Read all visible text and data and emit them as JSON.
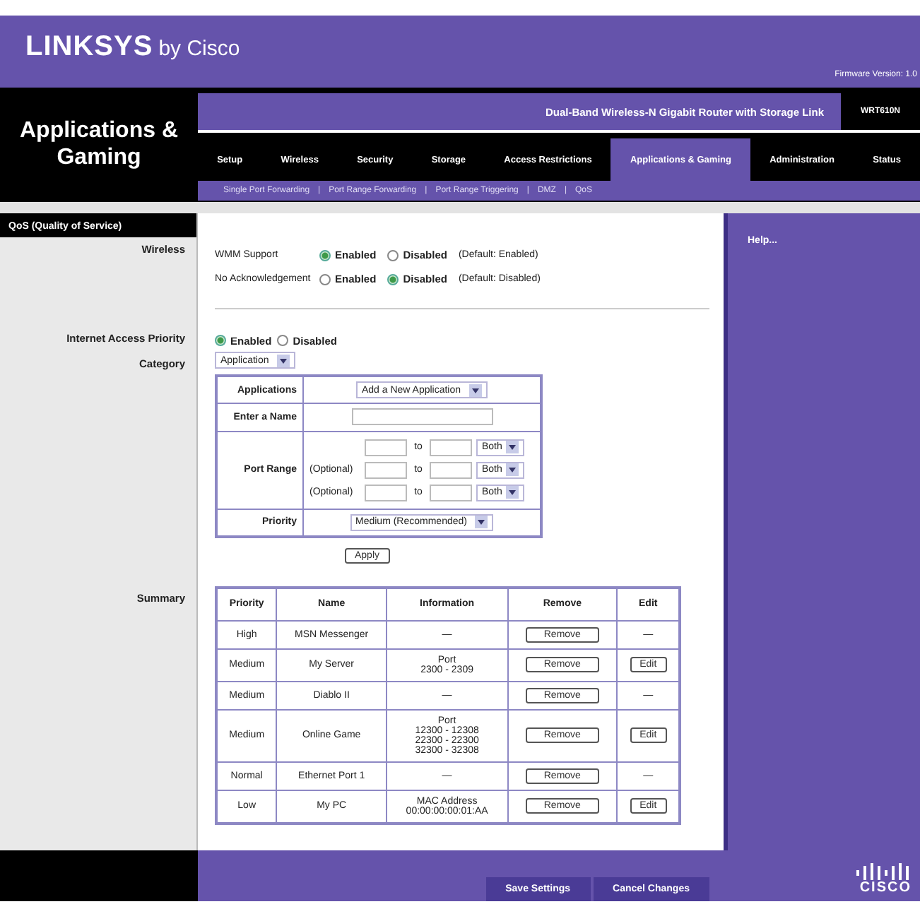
{
  "header": {
    "logo": "LINKSYS",
    "logo_suffix": "by Cisco",
    "firmware": "Firmware Version: 1.0"
  },
  "section_title": "Applications & Gaming",
  "product": "Dual-Band Wireless-N Gigabit Router with Storage Link",
  "model": "WRT610N",
  "tabs": [
    {
      "label": "Setup",
      "selected": false
    },
    {
      "label": "Wireless",
      "selected": false
    },
    {
      "label": "Security",
      "selected": false
    },
    {
      "label": "Storage",
      "selected": false
    },
    {
      "label": "Access Restrictions",
      "selected": false
    },
    {
      "label": "Applications & Gaming",
      "selected": true
    },
    {
      "label": "Administration",
      "selected": false
    },
    {
      "label": "Status",
      "selected": false
    }
  ],
  "subtabs": {
    "separator": "|",
    "items": [
      "Single Port Forwarding",
      "Port Range Forwarding",
      "Port Range Triggering",
      "DMZ",
      "QoS"
    ]
  },
  "sidebar": {
    "section": "QoS (Quality of Service)",
    "wireless": "Wireless",
    "internet_access_priority": "Internet Access Priority",
    "category": "Category",
    "summary": "Summary"
  },
  "wireless": [
    {
      "label": "WMM Support",
      "options": [
        {
          "label": "Enabled",
          "selected": true
        },
        {
          "label": "Disabled",
          "selected": false
        }
      ],
      "note": "(Default: Enabled)"
    },
    {
      "label": "No Acknowledgement",
      "options": [
        {
          "label": "Enabled",
          "selected": false
        },
        {
          "label": "Disabled",
          "selected": true
        }
      ],
      "note": "(Default: Disabled)"
    }
  ],
  "internet_access_priority": [
    {
      "label": "Enabled",
      "selected": true
    },
    {
      "label": "Disabled",
      "selected": false
    }
  ],
  "category": {
    "value": "Application"
  },
  "form": {
    "applications_label": "Applications",
    "applications_value": "Add a New Application",
    "name_label": "Enter a Name",
    "port_range_label": "Port Range",
    "port_rows": [
      {
        "to": "to",
        "protocol": "Both"
      },
      {
        "optional": "(Optional)",
        "to": "to",
        "protocol": "Both"
      },
      {
        "optional": "(Optional)",
        "to": "to",
        "protocol": "Both"
      }
    ],
    "priority_label": "Priority",
    "priority_value": "Medium (Recommended)",
    "apply": "Apply"
  },
  "summary": {
    "columns": [
      "Priority",
      "Name",
      "Information",
      "Remove",
      "Edit"
    ],
    "rows": [
      {
        "priority": "High",
        "name": "MSN Messenger",
        "info": [
          "—"
        ],
        "remove": "Remove",
        "edit": "—",
        "kind": "dash"
      },
      {
        "priority": "Medium",
        "name": "My Server",
        "info": [
          "Port",
          "2300 - 2309"
        ],
        "remove": "Remove",
        "edit": "Edit",
        "kind": "button"
      },
      {
        "priority": "Medium",
        "name": "Diablo II",
        "info": [
          "—"
        ],
        "remove": "Remove",
        "edit": "—",
        "kind": "dash"
      },
      {
        "priority": "Medium",
        "name": "Online Game",
        "info": [
          "Port",
          "12300 - 12308",
          "22300 - 22300",
          "32300 - 32308"
        ],
        "remove": "Remove",
        "edit": "Edit",
        "kind": "button"
      },
      {
        "priority": "Normal",
        "name": "Ethernet Port 1",
        "info": [
          "—"
        ],
        "remove": "Remove",
        "edit": "—",
        "kind": "dash"
      },
      {
        "priority": "Low",
        "name": "My PC",
        "info": [
          "MAC Address",
          "00:00:00:00:01:AA"
        ],
        "remove": "Remove",
        "edit": "Edit",
        "kind": "button"
      }
    ]
  },
  "help": "Help...",
  "footer": {
    "buttons": [
      "Save Settings",
      "Cancel Changes"
    ],
    "logo": "CISCO"
  }
}
